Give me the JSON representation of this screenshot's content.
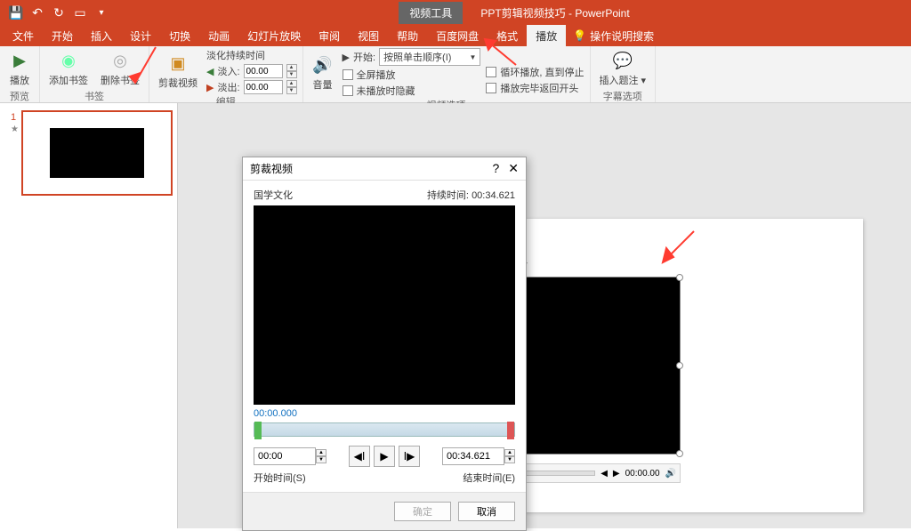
{
  "titlebar": {
    "context_tab": "视频工具",
    "doc_title": "PPT剪辑视频技巧 - PowerPoint"
  },
  "tabs": {
    "file": "文件",
    "home": "开始",
    "insert": "插入",
    "design": "设计",
    "transitions": "切换",
    "animations": "动画",
    "slideshow": "幻灯片放映",
    "review": "审阅",
    "view": "视图",
    "help": "帮助",
    "baidu": "百度网盘",
    "format": "格式",
    "playback": "播放",
    "tellme": "操作说明搜索"
  },
  "ribbon": {
    "play": "播放",
    "preview_group": "预览",
    "add_bookmark": "添加书签",
    "remove_bookmark": "删除书签",
    "bookmark_group": "书签",
    "trim_video": "剪裁视频",
    "fade_duration": "淡化持续时间",
    "fade_in": "淡入:",
    "fade_out": "淡出:",
    "fade_in_val": "00.00",
    "fade_out_val": "00.00",
    "edit_group": "编辑",
    "volume": "音量",
    "start_label": "开始:",
    "start_value": "按照单击顺序(I)",
    "fullscreen": "全屏播放",
    "hide_not_playing": "未播放时隐藏",
    "loop": "循环播放, 直到停止",
    "rewind": "播放完毕返回开头",
    "video_options_group": "视频选项",
    "insert_captions": "插入题注 ▾",
    "captions_group": "字幕选项"
  },
  "thumb": {
    "number": "1"
  },
  "video_controls": {
    "time": "00:00.00"
  },
  "dialog": {
    "title": "剪裁视频",
    "video_name": "国学文化",
    "duration_label": "持续时间:",
    "duration": "00:34.621",
    "current_time": "00:00.000",
    "start_time": "00:00",
    "end_time": "00:34.621",
    "start_label": "开始时间(S)",
    "end_label": "结束时间(E)",
    "ok": "确定",
    "cancel": "取消"
  }
}
